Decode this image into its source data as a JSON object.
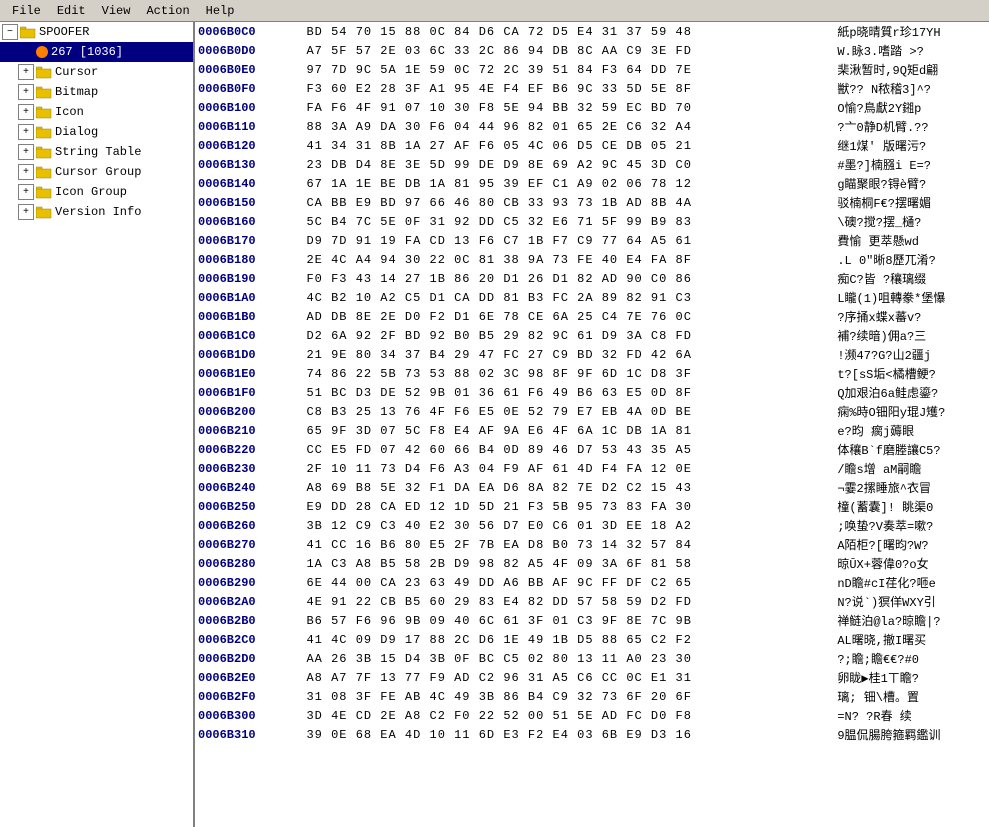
{
  "menubar": {
    "items": [
      "File",
      "Edit",
      "View",
      "Action",
      "Help"
    ]
  },
  "tree": {
    "nodes": [
      {
        "id": "spoofer",
        "label": "SPOOFER",
        "level": 0,
        "expander": "minus",
        "icon": "folder",
        "selected": false
      },
      {
        "id": "267",
        "label": "267 [1036]",
        "level": 1,
        "expander": "none",
        "icon": "orange-circle",
        "selected": true
      },
      {
        "id": "cursor",
        "label": "Cursor",
        "level": 1,
        "expander": "plus",
        "icon": "folder",
        "selected": false
      },
      {
        "id": "bitmap",
        "label": "Bitmap",
        "level": 1,
        "expander": "plus",
        "icon": "folder",
        "selected": false
      },
      {
        "id": "icon",
        "label": "Icon",
        "level": 1,
        "expander": "plus",
        "icon": "folder",
        "selected": false
      },
      {
        "id": "dialog",
        "label": "Dialog",
        "level": 1,
        "expander": "plus",
        "icon": "folder",
        "selected": false
      },
      {
        "id": "string-table",
        "label": "String Table",
        "level": 1,
        "expander": "plus",
        "icon": "folder",
        "selected": false
      },
      {
        "id": "cursor-group",
        "label": "Cursor Group",
        "level": 1,
        "expander": "plus",
        "icon": "folder",
        "selected": false
      },
      {
        "id": "icon-group",
        "label": "Icon Group",
        "level": 1,
        "expander": "plus",
        "icon": "folder",
        "selected": false
      },
      {
        "id": "version-info",
        "label": "Version Info",
        "level": 1,
        "expander": "plus",
        "icon": "folder",
        "selected": false
      }
    ]
  },
  "hex_rows": [
    {
      "addr": "0006B0C0",
      "hex": "BD 54 70 15 88 0C 84 D6 CA 72 D5 E4 31 37 59 48",
      "text": "紙p晓晴質r珍17YH"
    },
    {
      "addr": "0006B0D0",
      "hex": "A7 5F 57 2E 03 6C 33 2C 86 94 DB 8C AA C9 3E FD",
      "text": "W.眿3.嗜踏  >?"
    },
    {
      "addr": "0006B0E0",
      "hex": "97 7D 9C 5A 1E 59 0C 72 2C 39 51 84 F3 64 DD 7E",
      "text": "棐湫暂时,9Q矩d翩"
    },
    {
      "addr": "0006B0F0",
      "hex": "F3 60 E2 28 3F A1 95 4E F4 EF B6 9C 33 5D 5E 8F",
      "text": "獣?? N秾稽3]^?"
    },
    {
      "addr": "0006B100",
      "hex": "FA F6 4F 91 07 10 30 F8 5E 94 BB 32 59 EC BD 70",
      "text": "O愉?鳥獻2Y鎺p"
    },
    {
      "addr": "0006B110",
      "hex": "88 3A A9 DA 30 F6 04 44 96 82 01 65 2E C6 32 A4",
      "text": "?亠0静D机臂.??"
    },
    {
      "addr": "0006B120",
      "hex": "41 34 31 8B 1A 27 AF F6 05 4C 06 D5 CE DB 05 21",
      "text": "继1煤'  版曙污?"
    },
    {
      "addr": "0006B130",
      "hex": "23 DB D4 8E 3E 5D 99 DE D9 8E 69 A2 9C 45 3D C0",
      "text": "#墨?]楠膙i  E=?"
    },
    {
      "addr": "0006B140",
      "hex": "67 1A 1E BE DB 1A 81 95 39 EF C1 A9 02 06 78 12",
      "text": "g瞄聚眼?锝è臂?"
    },
    {
      "addr": "0006B150",
      "hex": "CA BB E9 BD 97 66 46 80 CB 33 93 73 1B AD 8B 4A",
      "text": "驳楠桐F€?摆曙媚"
    },
    {
      "addr": "0006B160",
      "hex": "5C B4 7C 5E 0F 31 92 DD C5 32 E6 71 5F 99 B9 83",
      "text": "\\礇?搅?摆_樋?"
    },
    {
      "addr": "0006B170",
      "hex": "D9 7D 91 19 FA CD 13 F6 C7 1B F7 C9 77 64 A5 61",
      "text": "費愉 更萃懸wd"
    },
    {
      "addr": "0006B180",
      "hex": "2E 4C A4 94 30 22 0C 81 38 9A 73 FE 40 E4 FA 8F",
      "text": ".L  0\"晰8歷兀淆?"
    },
    {
      "addr": "0006B190",
      "hex": "F0 F3 43 14 27 1B 86 20 D1 26 D1 82 AD 90 C0 86",
      "text": "痴C?皆 ?穰璃缀"
    },
    {
      "addr": "0006B1A0",
      "hex": "4C B2 10 A2 C5 D1 CA DD 81 B3 FC 2A 89 82 91 C3",
      "text": "L矓(1)咀轉豢*堡懪"
    },
    {
      "addr": "0006B1B0",
      "hex": "AD DB 8E 2E D0 F2 D1 6E 78 CE 6A 25 C4 7E 76 0C",
      "text": "?序捅x蝶x蕃v?"
    },
    {
      "addr": "0006B1C0",
      "hex": "D2 6A 92 2F BD 92 B0 B5 29 82 9C 61 D9 3A C8 FD",
      "text": "補?续暗)佣a?三"
    },
    {
      "addr": "0006B1D0",
      "hex": "21 9E 80 34 37 B4 29 47 FC 27 C9 BD 32 FD 42 6A",
      "text": "!濒47?G?山2疆j"
    },
    {
      "addr": "0006B1E0",
      "hex": "74 86 22 5B 73 53 88 02 3C 98 8F 9F 6D 1C D8 3F",
      "text": "t?[sS垢<橘槽鲠?"
    },
    {
      "addr": "0006B1F0",
      "hex": "51 BC D3 DE 52 9B 01 36 61 F6 49 B6 63 E5 0D 8F",
      "text": "Q加艰泊6a鲑虑鎏?"
    },
    {
      "addr": "0006B200",
      "hex": "C8 B3 25 13 76 4F F6 E5 0E 52 79 E7 EB 4A 0D BE",
      "text": "痫%時O钿阳y琨J矱?"
    },
    {
      "addr": "0006B210",
      "hex": "65 9F 3D 07 5C F8 E4 AF 9A E6 4F 6A 1C DB 1A 81",
      "text": "e?昀  瘸j薅眼"
    },
    {
      "addr": "0006B220",
      "hex": "CC E5 FD 07 42 60 66 B4 0D 89 46 D7 53 43 35 A5",
      "text": "体穰B`f磨塍讓C5?"
    },
    {
      "addr": "0006B230",
      "hex": "2F 10 11 73 D4 F6 A3 04 F9 AF 61 4D F4 FA 12 0E",
      "text": "/瞻s增    aM嗣瞻"
    },
    {
      "addr": "0006B240",
      "hex": "A8 69 B8 5E 32 F1 DA EA D6 8A 82 7E D2 C2 15 43",
      "text": "¬霎2摞睡旅^衣冒"
    },
    {
      "addr": "0006B250",
      "hex": "E9 DD 28 CA ED 12 1D 5D 21 F3 5B 95 73 83 FA 30",
      "text": "橦(蓄囊]! 眺渠0"
    },
    {
      "addr": "0006B260",
      "hex": "3B 12 C9 C3 40 E2 30 56 D7 E0 C6 01 3D EE 18 A2",
      "text": ";唤蛰?V奏萃=嗽?"
    },
    {
      "addr": "0006B270",
      "hex": "41 CC 16 B6 80 E5 2F 7B EA D8 B0 73 14 32 57 84",
      "text": "A陌柜?[曙昀?W?"
    },
    {
      "addr": "0006B280",
      "hex": "1A C3 A8 B5 58 2B D9 98 82 A5 4F 09 3A 6F 81 58",
      "text": "晾ŪX+蓉偉0?o女"
    },
    {
      "addr": "0006B290",
      "hex": "6E 44 00 CA 23 63 49 DD A6 BB AF 9C FF DF C2 65",
      "text": "nD瞻#cI荏化?咂e"
    },
    {
      "addr": "0006B2A0",
      "hex": "4E 91 22 CB B5 60 29 83 E4 82 DD 57 58 59 D2 FD",
      "text": "N?说`)猽佯WXY引"
    },
    {
      "addr": "0006B2B0",
      "hex": "B6 57 F6 96 9B 09 40 6C 61 3F 01 C3 9F 8E 7C 9B",
      "text": "禅鲢泊@la?晾瞻|?"
    },
    {
      "addr": "0006B2C0",
      "hex": "41 4C 09 D9 17 88 2C D6 1E 49 1B D5 88 65 C2 F2",
      "text": "AL曙晓,撤I曙买"
    },
    {
      "addr": "0006B2D0",
      "hex": "AA 26 3B 15 D4 3B 0F BC C5 02 80 13 11 A0 23 30",
      "text": "?;瞻;瞻€€?#0"
    },
    {
      "addr": "0006B2E0",
      "hex": "A8 A7 7F 13 77 F9 AD C2 96 31 A5 C6 CC 0C E1 31",
      "text": "卵眬▶桂1ㄒ瞻?"
    },
    {
      "addr": "0006B2F0",
      "hex": "31 08 3F FE AB 4C 49 3B 86 B4 C9 32 73 6F 20 6F",
      "text": "璃; 钿\\槽。置"
    },
    {
      "addr": "0006B300",
      "hex": "3D 4E CD 2E A8 C2 F0 22 52 00 51 5E AD FC D0 F8",
      "text": "=N?  ?R春  续"
    },
    {
      "addr": "0006B310",
      "hex": "39 0E 68 EA 4D 10 11 6D E3 F2 E4 03 6B E9 D3 16",
      "text": "9腽侃腸胯箍羁鑑训"
    }
  ]
}
